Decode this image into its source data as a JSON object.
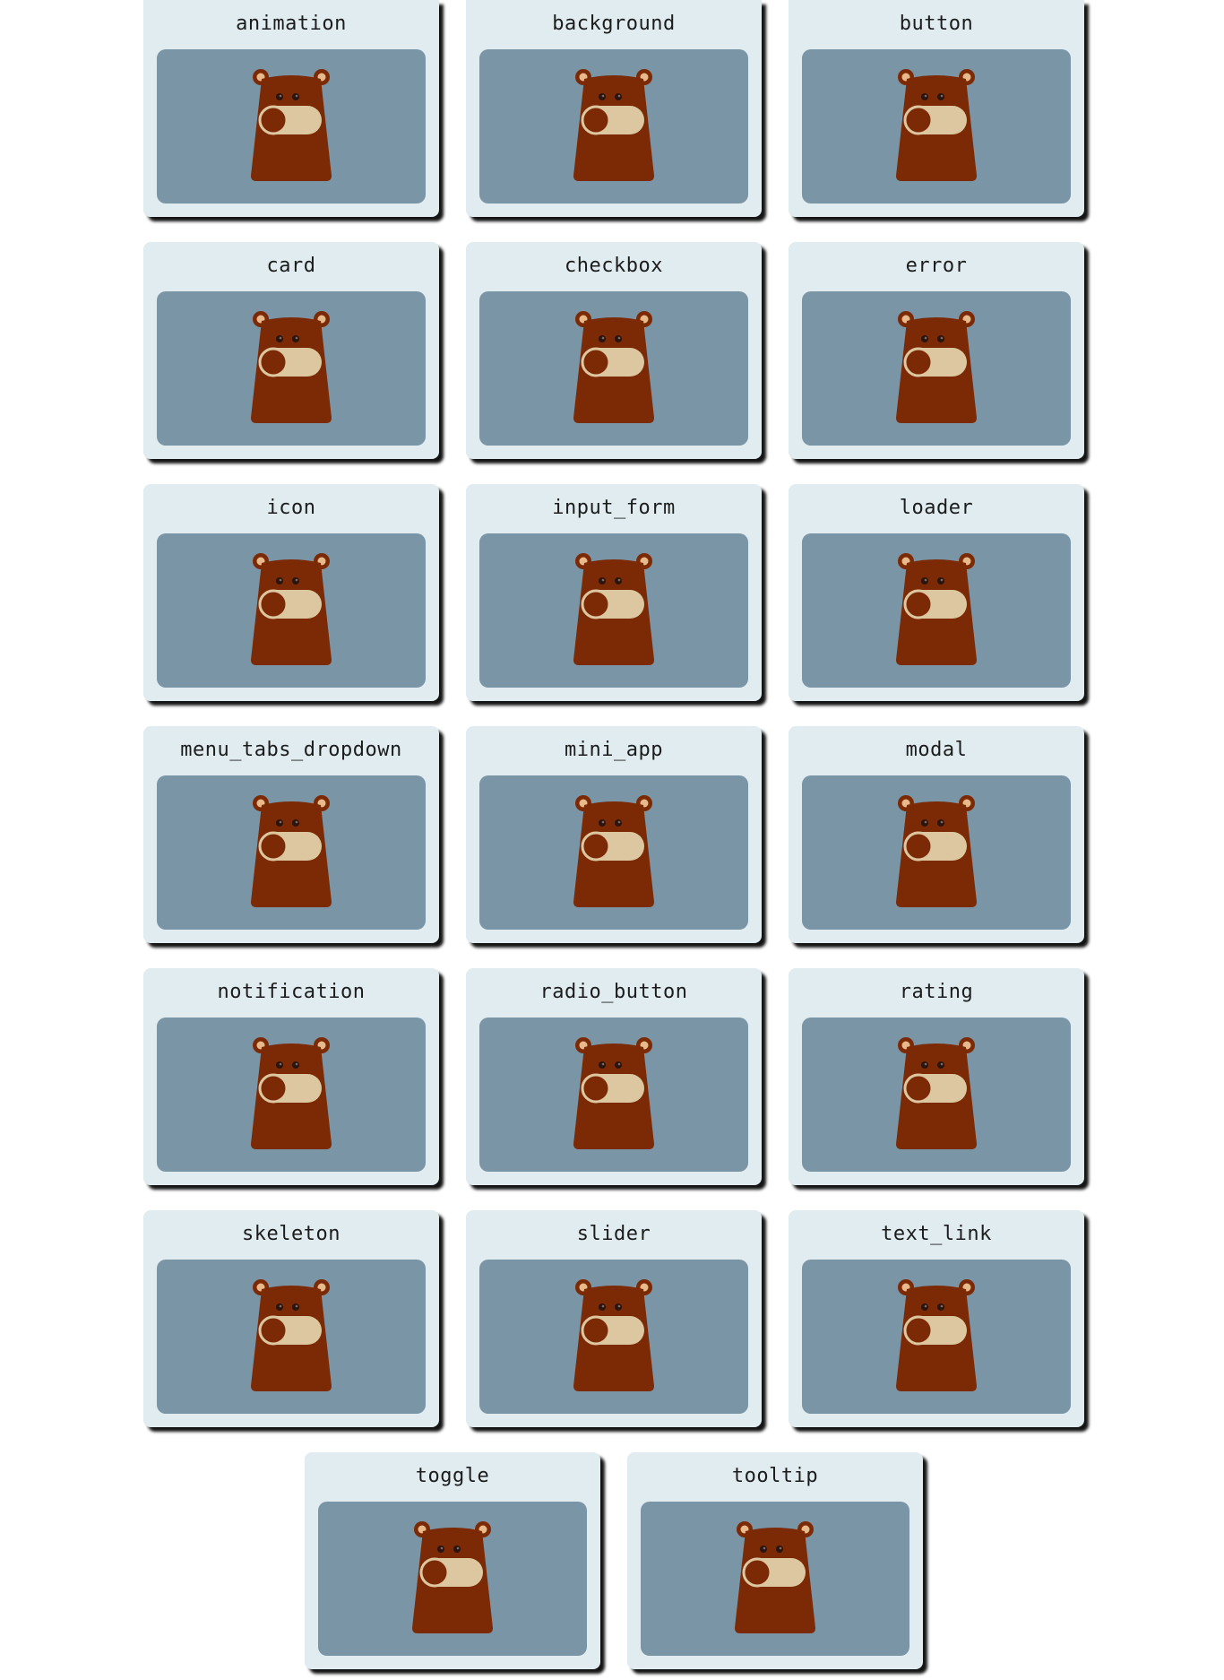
{
  "cards": [
    {
      "label": "animation"
    },
    {
      "label": "background"
    },
    {
      "label": "button"
    },
    {
      "label": "card"
    },
    {
      "label": "checkbox"
    },
    {
      "label": "error"
    },
    {
      "label": "icon"
    },
    {
      "label": "input_form"
    },
    {
      "label": "loader"
    },
    {
      "label": "menu_tabs_dropdown"
    },
    {
      "label": "mini_app"
    },
    {
      "label": "modal"
    },
    {
      "label": "notification"
    },
    {
      "label": "radio_button"
    },
    {
      "label": "rating"
    },
    {
      "label": "skeleton"
    },
    {
      "label": "slider"
    },
    {
      "label": "text_link"
    },
    {
      "label": "toggle"
    },
    {
      "label": "tooltip"
    }
  ],
  "colors": {
    "card_background": "#e0ecf0",
    "preview_background": "#7a95a6",
    "bear_body": "#7b2a05",
    "bear_ear_inner": "#e8b98a",
    "toggle_track": "#dcc7a0",
    "bear_eyes": "#3a1f18"
  },
  "icon": "bear-toggle-icon"
}
